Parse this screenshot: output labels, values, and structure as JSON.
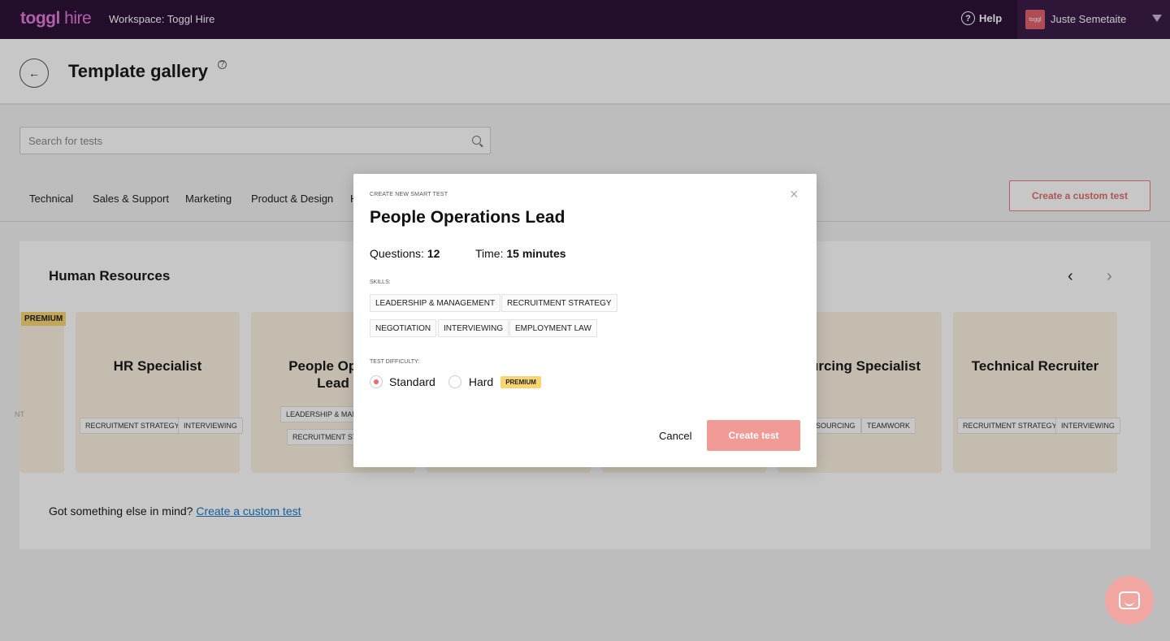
{
  "topbar": {
    "logo_text": "toggl",
    "logo_suffix": "hire",
    "workspace": "Workspace: Toggl Hire",
    "help_label": "Help",
    "avatar_text": "toggl",
    "user_name": "Juste Semetaite"
  },
  "header": {
    "title": "Template gallery",
    "back_icon": "arrow-left-icon"
  },
  "search": {
    "placeholder": "Search for tests"
  },
  "tabs": [
    "Technical",
    "Sales & Support",
    "Marketing",
    "Product & Design",
    "H"
  ],
  "create_custom_top": "Create a custom test",
  "section": {
    "title": "Human Resources"
  },
  "cards": [
    {
      "title": "",
      "chips": [
        "NT",
        "..."
      ],
      "premium": "PREMIUM"
    },
    {
      "title": "HR Specialist",
      "chips": [
        "RECRUITMENT STRATEGY",
        "INTERVIEWING"
      ]
    },
    {
      "title": "People Operations Lead",
      "title_visible": "People Opera\nLead",
      "chips": [
        "LEADERSHIP & MANA",
        "RECRUITMENT STR"
      ]
    },
    {
      "title": "urcing Specialist",
      "chips": [
        "SOURCING",
        "TEAMWORK"
      ]
    },
    {
      "title": "Technical Recruiter",
      "chips": [
        "RECRUITMENT STRATEGY",
        "INTERVIEWING"
      ]
    }
  ],
  "footer": {
    "text": "Got something else in mind?",
    "link": "Create a custom test"
  },
  "modal": {
    "eyebrow": "CREATE NEW SMART TEST",
    "title": "People Operations Lead",
    "questions_label": "Questions:",
    "questions_value": "12",
    "time_label": "Time:",
    "time_value": "15 minutes",
    "skills_label": "SKILLS:",
    "skills": [
      "LEADERSHIP & MANAGEMENT",
      "RECRUITMENT STRATEGY",
      "NEGOTIATION",
      "INTERVIEWING",
      "EMPLOYMENT LAW"
    ],
    "difficulty_label": "TEST DIFFICULTY:",
    "difficulty_options": [
      {
        "label": "Standard",
        "selected": true
      },
      {
        "label": "Hard",
        "selected": false,
        "badge": "PREMIUM"
      }
    ],
    "cancel_label": "Cancel",
    "create_label": "Create test"
  },
  "colors": {
    "topbar_bg": "#2c1338",
    "accent": "#e26e6e",
    "create_button": "#f29b96",
    "premium": "#f9d572",
    "card_bg": "#fbf3e1",
    "link": "#1679c4"
  }
}
